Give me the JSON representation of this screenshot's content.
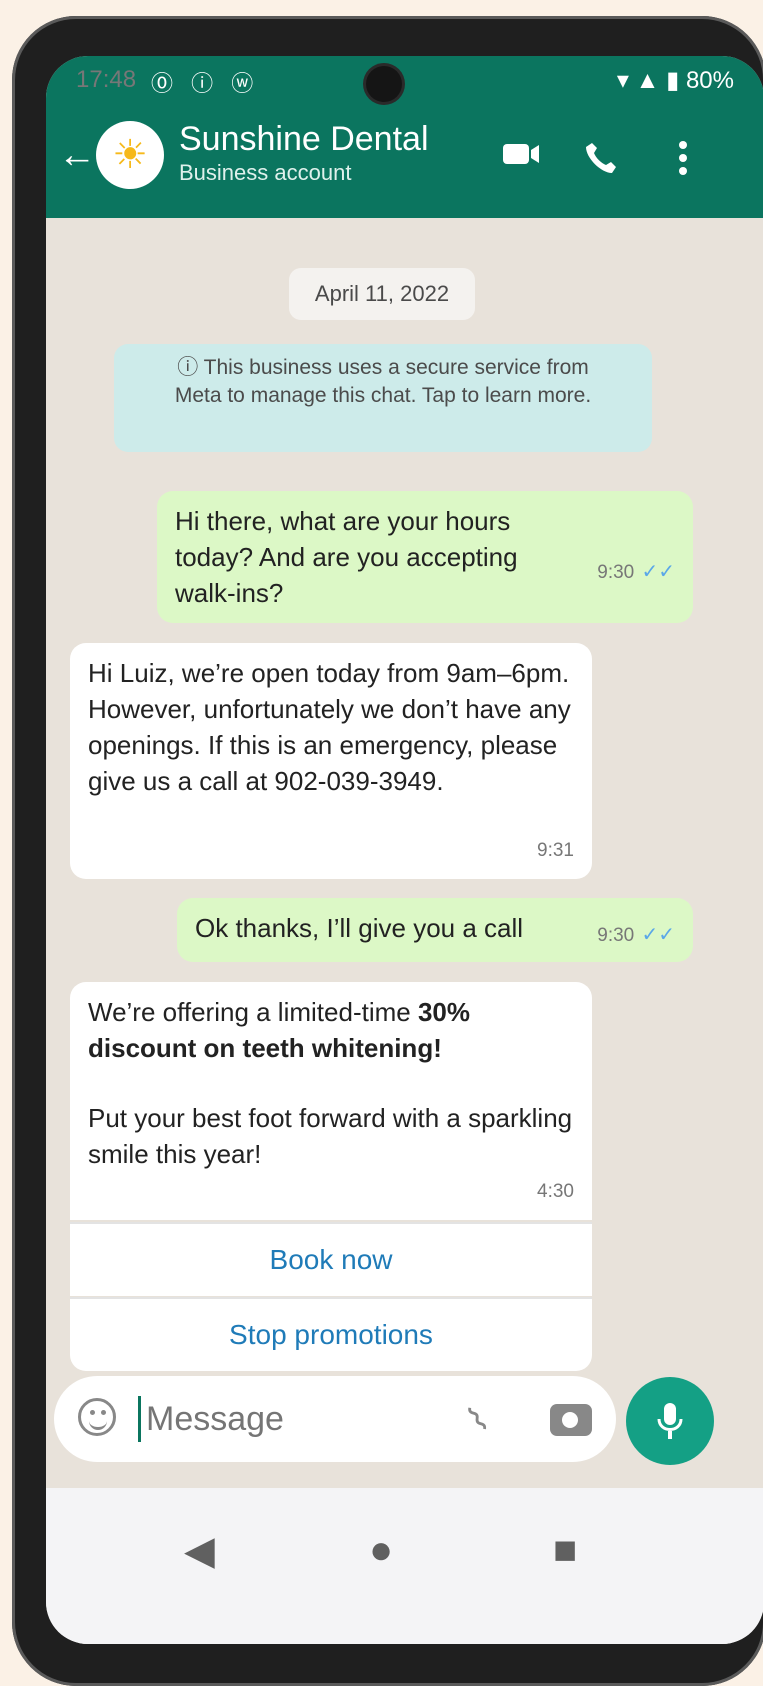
{
  "status": {
    "time": "17:48",
    "left_icons": "⓪ ⓘ ⓦ",
    "battery": "80%"
  },
  "header": {
    "back_icon": "←",
    "avatar_icon": "☀",
    "title": "Sunshine Dental",
    "subtitle": "Business account",
    "video_icon": "video-icon",
    "phone_icon": "phone-icon",
    "more_icon": "more-icon"
  },
  "chat": {
    "date": "April 11, 2022",
    "notice": "This business uses a secure service from Meta to manage this chat. Tap to learn more.",
    "messages": [
      {
        "text": "Hi there, what are your hours today? And are you accepting walk-ins?",
        "time": "9:30",
        "ticks": "✓✓"
      },
      {
        "text": "Hi Luiz, we’re open today from 9am–6pm. However, unfortunately we don’t have any openings. If this is an emergency, please give us a call at 902-039-3949.",
        "time": "9:31"
      },
      {
        "text": "Ok thanks, I’ll give you a call",
        "time": "9:30",
        "ticks": "✓✓"
      },
      {
        "text_prefix": "We’re offering a limited-time ",
        "text_bold": "30% discount on teeth whitening!",
        "text_2": "Put your best foot forward with a sparkling smile this year!",
        "time": "4:30"
      }
    ],
    "buttons": {
      "book": "Book now",
      "stop": "Stop promotions"
    }
  },
  "input": {
    "placeholder": "Message",
    "emoji_icon": "emoji-icon",
    "attach_icon": "paperclip-icon",
    "camera_icon": "camera-icon",
    "mic_icon": "mic-icon"
  },
  "navigation": {
    "back": "◀",
    "home": "●",
    "recents": "■"
  },
  "colors": {
    "header": "#0b755f",
    "accent_green": "#14a085",
    "link_blue": "#1f7bb8"
  }
}
